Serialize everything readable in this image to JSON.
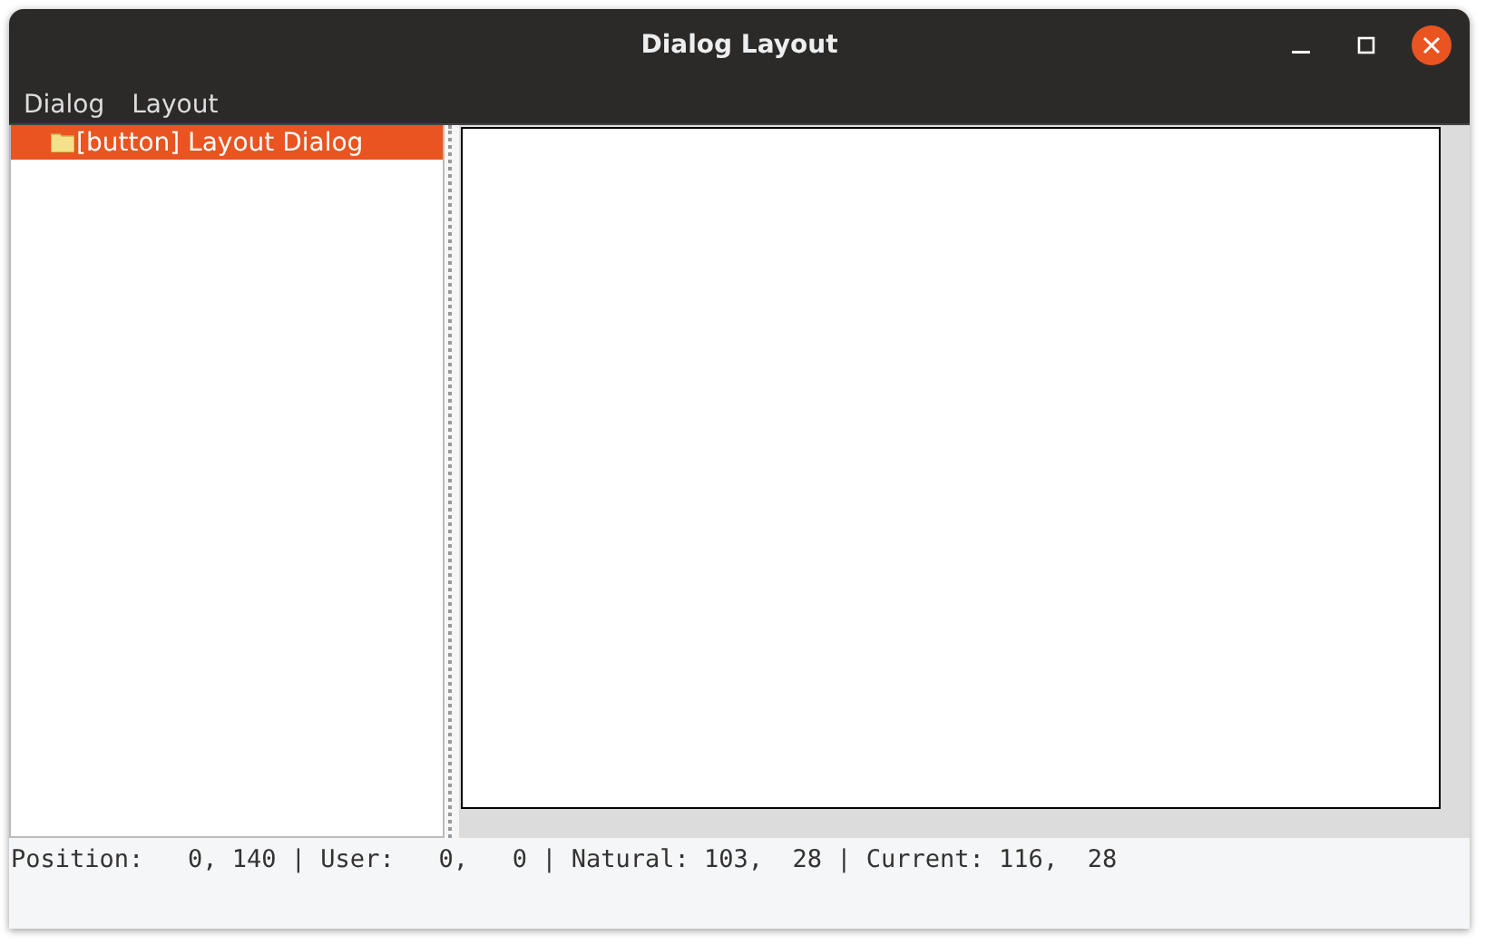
{
  "window": {
    "title": "Dialog Layout"
  },
  "menu": [
    "Dialog",
    "Layout"
  ],
  "tree": [
    {
      "label": "[button] Layout Dialog",
      "selected": true
    }
  ],
  "status_bar": "Position:   0, 140 | User:   0,   0 | Natural: 103,  28 | Current: 116,  28"
}
